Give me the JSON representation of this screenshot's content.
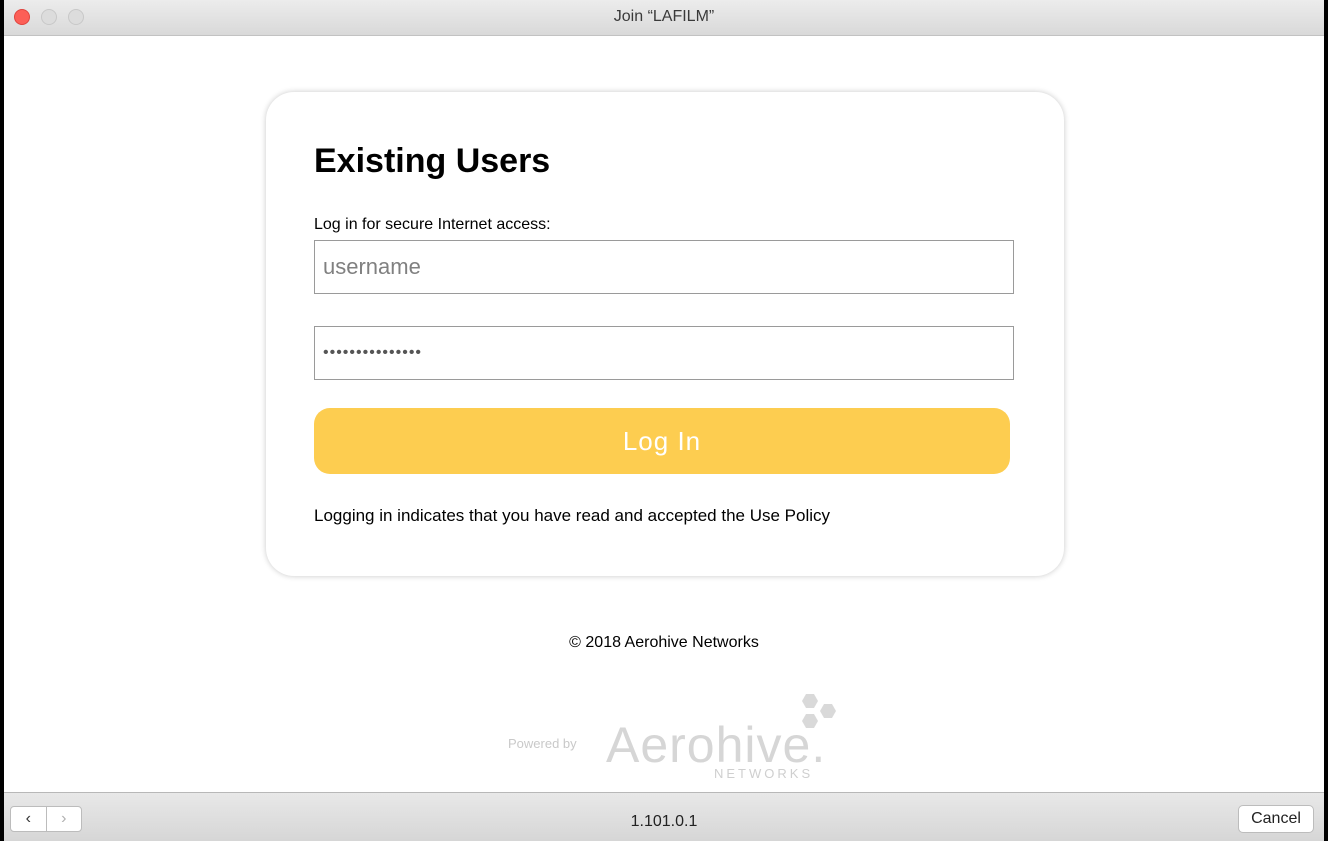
{
  "window": {
    "title": "Join “LAFILM”"
  },
  "card": {
    "heading": "Existing Users",
    "prompt": "Log in for secure Internet access:",
    "username_placeholder": "username",
    "password_value": "•••••••••••••••",
    "login_label": "Log In",
    "policy_text": "Logging in indicates that you have read and accepted the Use Policy",
    "accent_color": "#fdcd50"
  },
  "footer": {
    "copyright": "© 2018 Aerohive Networks",
    "powered_by": "Powered by",
    "brand_name": "Aerohive.",
    "brand_sub": "NETWORKS",
    "logo_icon": "hexagon-cluster-icon"
  },
  "bottombar": {
    "back_icon": "‹",
    "forward_icon": "›",
    "url": "1.101.0.1",
    "cancel_label": "Cancel"
  }
}
